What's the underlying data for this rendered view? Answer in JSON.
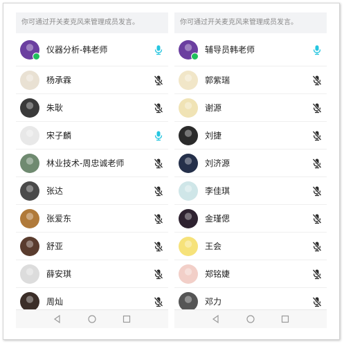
{
  "left_panel": {
    "hint": "你可通过开关麦克风来管理成员发言。",
    "members": [
      {
        "name": "仪器分析-韩老师",
        "mic": "mic-on",
        "online": true,
        "avatar_color": "#6b3fa0",
        "avatar_icon": "colored-pencils-avatar"
      },
      {
        "name": "杨承霖",
        "mic": "mic-off",
        "online": false,
        "avatar_color": "#e9e1d3",
        "avatar_icon": "calligraphy-avatar"
      },
      {
        "name": "朱耿",
        "mic": "mic-off",
        "online": false,
        "avatar_color": "#3a3a3a",
        "avatar_icon": "person-avatar"
      },
      {
        "name": "宋子麟",
        "mic": "mic-on",
        "online": false,
        "avatar_color": "#e8e8e8",
        "avatar_icon": "anime-avatar"
      },
      {
        "name": "林业技术-周忠诚老师",
        "mic": "mic-off",
        "online": false,
        "avatar_color": "#6f8a70",
        "avatar_icon": "landscape-avatar"
      },
      {
        "name": "张达",
        "mic": "mic-off",
        "online": false,
        "avatar_color": "#4a4a4a",
        "avatar_icon": "person-avatar"
      },
      {
        "name": "张爱东",
        "mic": "mic-off",
        "online": false,
        "avatar_color": "#b07a3a",
        "avatar_icon": "cartoon-bear-avatar"
      },
      {
        "name": "舒亚",
        "mic": "mic-off",
        "online": false,
        "avatar_color": "#5a3c2e",
        "avatar_icon": "person-avatar"
      },
      {
        "name": "薛安琪",
        "mic": "mic-off",
        "online": false,
        "avatar_color": "#dcdcdc",
        "avatar_icon": "person-avatar"
      },
      {
        "name": "周灿",
        "mic": "mic-off",
        "online": false,
        "avatar_color": "#3b2e28",
        "avatar_icon": "person-avatar"
      }
    ]
  },
  "right_panel": {
    "hint": "你可通过开关麦克风来管理成员发言。",
    "members": [
      {
        "name": "辅导员韩老师",
        "mic": "mic-on",
        "online": true,
        "avatar_color": "#6b3fa0",
        "avatar_icon": "colored-pencils-avatar"
      },
      {
        "name": "郭紫瑞",
        "mic": "mic-off",
        "online": false,
        "avatar_color": "#f1e6c8",
        "avatar_icon": "cartoon-avatar"
      },
      {
        "name": "谢源",
        "mic": "mic-off",
        "online": false,
        "avatar_color": "#f0e3b5",
        "avatar_icon": "cartoon-avatar"
      },
      {
        "name": "刘捷",
        "mic": "mic-off",
        "online": false,
        "avatar_color": "#2b2b2b",
        "avatar_icon": "person-avatar"
      },
      {
        "name": "刘济源",
        "mic": "mic-off",
        "online": false,
        "avatar_color": "#25304a",
        "avatar_icon": "night-sky-avatar"
      },
      {
        "name": "李佳琪",
        "mic": "mic-off",
        "online": false,
        "avatar_color": "#cfe6e8",
        "avatar_icon": "drawing-avatar"
      },
      {
        "name": "金瑾偲",
        "mic": "mic-off",
        "online": false,
        "avatar_color": "#2e2230",
        "avatar_icon": "person-avatar"
      },
      {
        "name": "王会",
        "mic": "mic-off",
        "online": false,
        "avatar_color": "#f6e27a",
        "avatar_icon": "pikachu-avatar"
      },
      {
        "name": "郑铭婕",
        "mic": "mic-off",
        "online": false,
        "avatar_color": "#f2cfc8",
        "avatar_icon": "person-avatar"
      },
      {
        "name": "邓力",
        "mic": "mic-off",
        "online": false,
        "avatar_color": "#555555",
        "avatar_icon": "person-avatar"
      }
    ]
  },
  "colors": {
    "mic_on": "#26c6e0",
    "mic_off": "#2a2a2a",
    "online_badge": "#20c05c"
  },
  "navbar_icons": [
    "back-icon",
    "home-icon",
    "recents-icon"
  ]
}
